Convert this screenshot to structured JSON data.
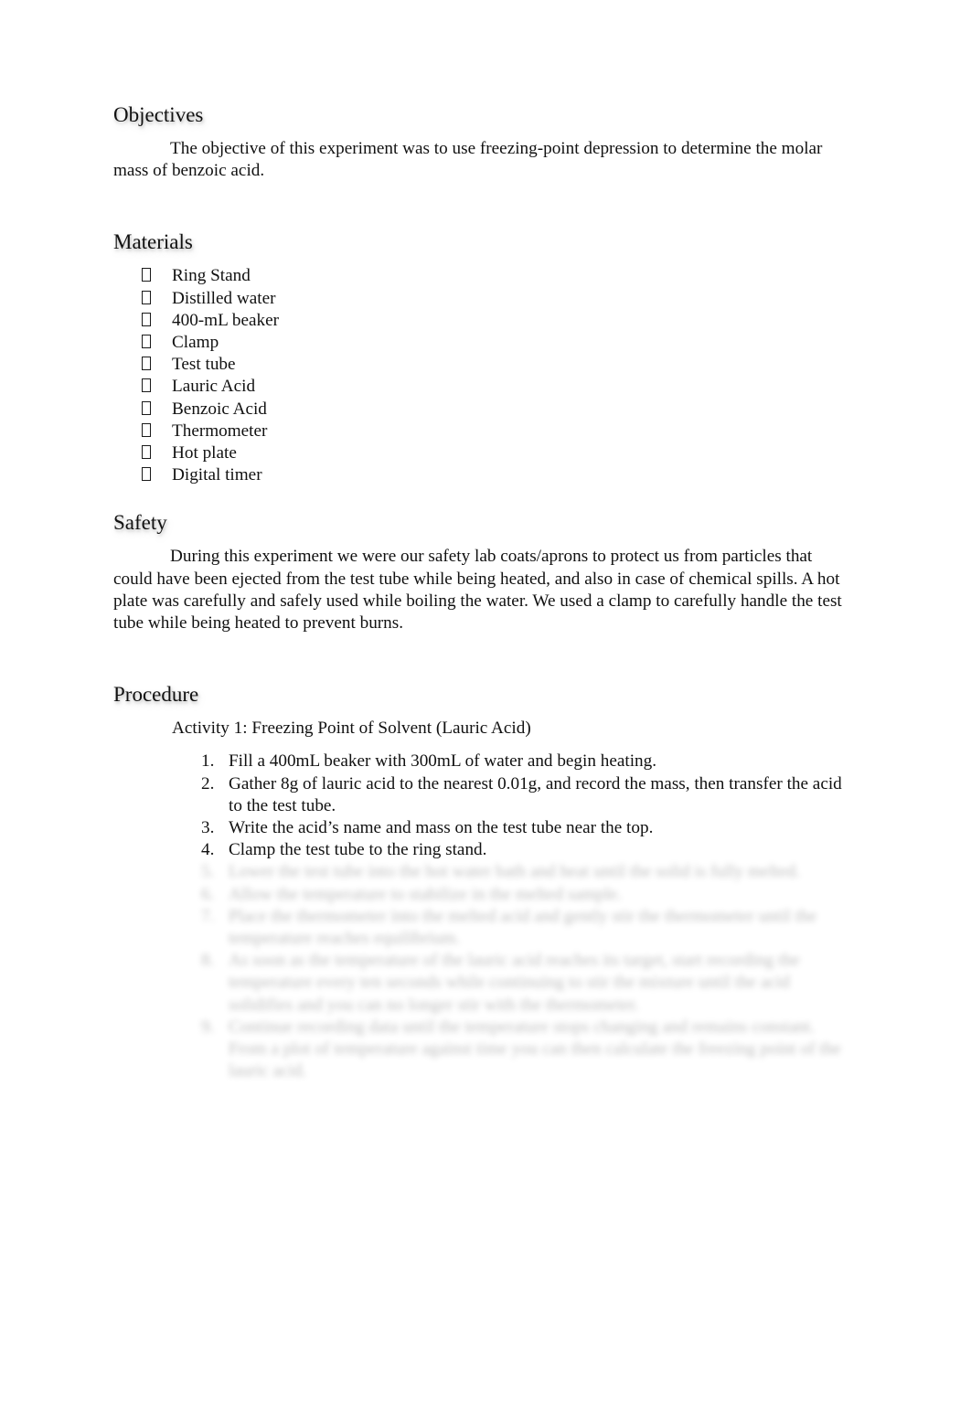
{
  "document": {
    "background_color": "#ffffff",
    "text_color": "#111111"
  },
  "sections": {
    "objectives": {
      "heading": "Objectives",
      "paragraph": "The objective of this experiment was to use freezing-point depression to determine the molar mass of benzoic acid."
    },
    "materials": {
      "heading": "Materials",
      "bullet_glyph": "missing-glyph-box",
      "items": [
        "Ring Stand",
        "Distilled water",
        "400-mL beaker",
        "Clamp",
        "Test tube",
        "Lauric Acid",
        "Benzoic Acid",
        "Thermometer",
        "Hot plate",
        "Digital timer"
      ]
    },
    "safety": {
      "heading": "Safety",
      "paragraph": "During this experiment we were our safety lab coats/aprons to protect us from particles that could have been ejected from the test tube while being heated, and also in case of chemical spills. A hot plate was carefully and safely used while boiling the water. We used a clamp to carefully handle the test tube while being heated to prevent burns."
    },
    "procedure": {
      "heading": "Procedure",
      "activity_label": "Activity 1: Freezing Point of Solvent (Lauric Acid)",
      "steps": [
        {
          "number": "1.",
          "text": "Fill a 400mL beaker with 300mL of water and begin heating.",
          "legible": true
        },
        {
          "number": "2.",
          "text": "Gather 8g of lauric acid to the nearest 0.01g, and record the mass, then transfer the acid to the test tube.",
          "legible": true
        },
        {
          "number": "3.",
          "text": "Write the acid’s name and mass on the test tube near the top.",
          "legible": true
        },
        {
          "number": "4.",
          "text": "Clamp the test tube to the ring stand.",
          "legible": true
        }
      ],
      "obscured_steps": [
        {
          "number": "5.",
          "text": "Lower the test tube into the hot water bath and heat until the solid is fully melted.",
          "legible": false
        },
        {
          "number": "6.",
          "text": "Allow the temperature to stabilize in the melted sample.",
          "legible": false
        },
        {
          "number": "7.",
          "text": "Place the thermometer into the melted acid and gently stir the thermometer until the temperature reaches equilibrium.",
          "legible": false
        },
        {
          "number": "8.",
          "text": "As soon as the temperature of the lauric acid reaches its target, start recording the temperature every ten seconds while continuing to stir the mixture until the acid solidifies and you can no longer stir with the thermometer.",
          "legible": false
        },
        {
          "number": "9.",
          "text": "Continue recording data until the temperature stops changing and remains constant. From a plot of temperature against time you can then calculate the freezing point of the lauric acid.",
          "legible": false
        }
      ]
    }
  }
}
